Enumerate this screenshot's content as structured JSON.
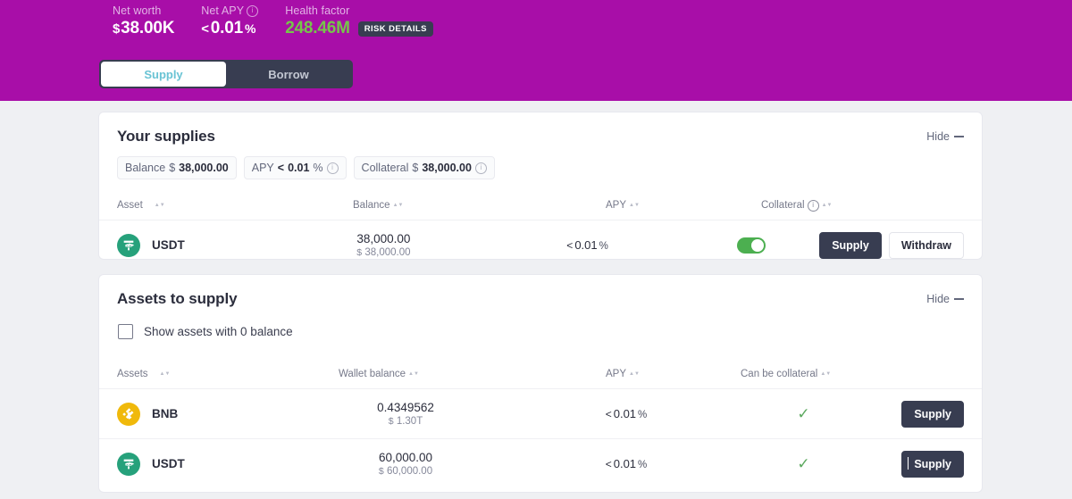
{
  "header": {
    "metrics": [
      {
        "label": "Net worth",
        "currency": "$",
        "value": "38.00K",
        "has_info": false
      },
      {
        "label": "Net APY",
        "prefix": "<",
        "value": "0.01",
        "suffix": "%",
        "has_info": true
      },
      {
        "label": "Health factor",
        "value": "248.46M",
        "has_info": false,
        "badge": "RISK DETAILS"
      }
    ],
    "tabs": [
      {
        "label": "Supply",
        "active": true
      },
      {
        "label": "Borrow",
        "active": false
      }
    ],
    "background_color": "#a80ea8",
    "health_color": "#76c54a"
  },
  "your_supplies": {
    "title": "Your supplies",
    "hide_label": "Hide",
    "chips": [
      {
        "label": "Balance",
        "symbol": "$",
        "value": "38,000.00",
        "info": false
      },
      {
        "label": "APY",
        "prefix": "<",
        "value": "0.01",
        "symbol": "%",
        "info": true
      },
      {
        "label": "Collateral",
        "symbol": "$",
        "value": "38,000.00",
        "info": true
      }
    ],
    "columns": [
      {
        "label": "Asset",
        "sortable": true,
        "info": false
      },
      {
        "label": "Balance",
        "sortable": true,
        "info": false
      },
      {
        "label": "APY",
        "sortable": true,
        "info": false
      },
      {
        "label": "Collateral",
        "sortable": true,
        "info": true
      }
    ],
    "rows": [
      {
        "asset": "USDT",
        "icon": "usdt-icon",
        "balance": "38,000.00",
        "balance_usd_symbol": "$",
        "balance_usd": "38,000.00",
        "apy_prefix": "<",
        "apy": "0.01",
        "apy_symbol": "%",
        "collateral_enabled": true,
        "supply_label": "Supply",
        "withdraw_label": "Withdraw"
      }
    ]
  },
  "assets_to_supply": {
    "title": "Assets to supply",
    "hide_label": "Hide",
    "checkbox_label": "Show assets with 0 balance",
    "checkbox_checked": false,
    "columns": [
      {
        "label": "Assets",
        "sortable": true
      },
      {
        "label": "Wallet balance",
        "sortable": true
      },
      {
        "label": "APY",
        "sortable": true
      },
      {
        "label": "Can be collateral",
        "sortable": true
      }
    ],
    "rows": [
      {
        "asset": "BNB",
        "icon": "bnb-icon",
        "balance": "0.4349562",
        "balance_usd_symbol": "$",
        "balance_usd": "1.30T",
        "apy_prefix": "<",
        "apy": "0.01",
        "apy_symbol": "%",
        "can_be_collateral": true,
        "supply_label": "Supply"
      },
      {
        "asset": "USDT",
        "icon": "usdt-icon",
        "balance": "60,000.00",
        "balance_usd_symbol": "$",
        "balance_usd": "60,000.00",
        "apy_prefix": "<",
        "apy": "0.01",
        "apy_symbol": "%",
        "can_be_collateral": true,
        "supply_label": "Supply"
      }
    ]
  }
}
